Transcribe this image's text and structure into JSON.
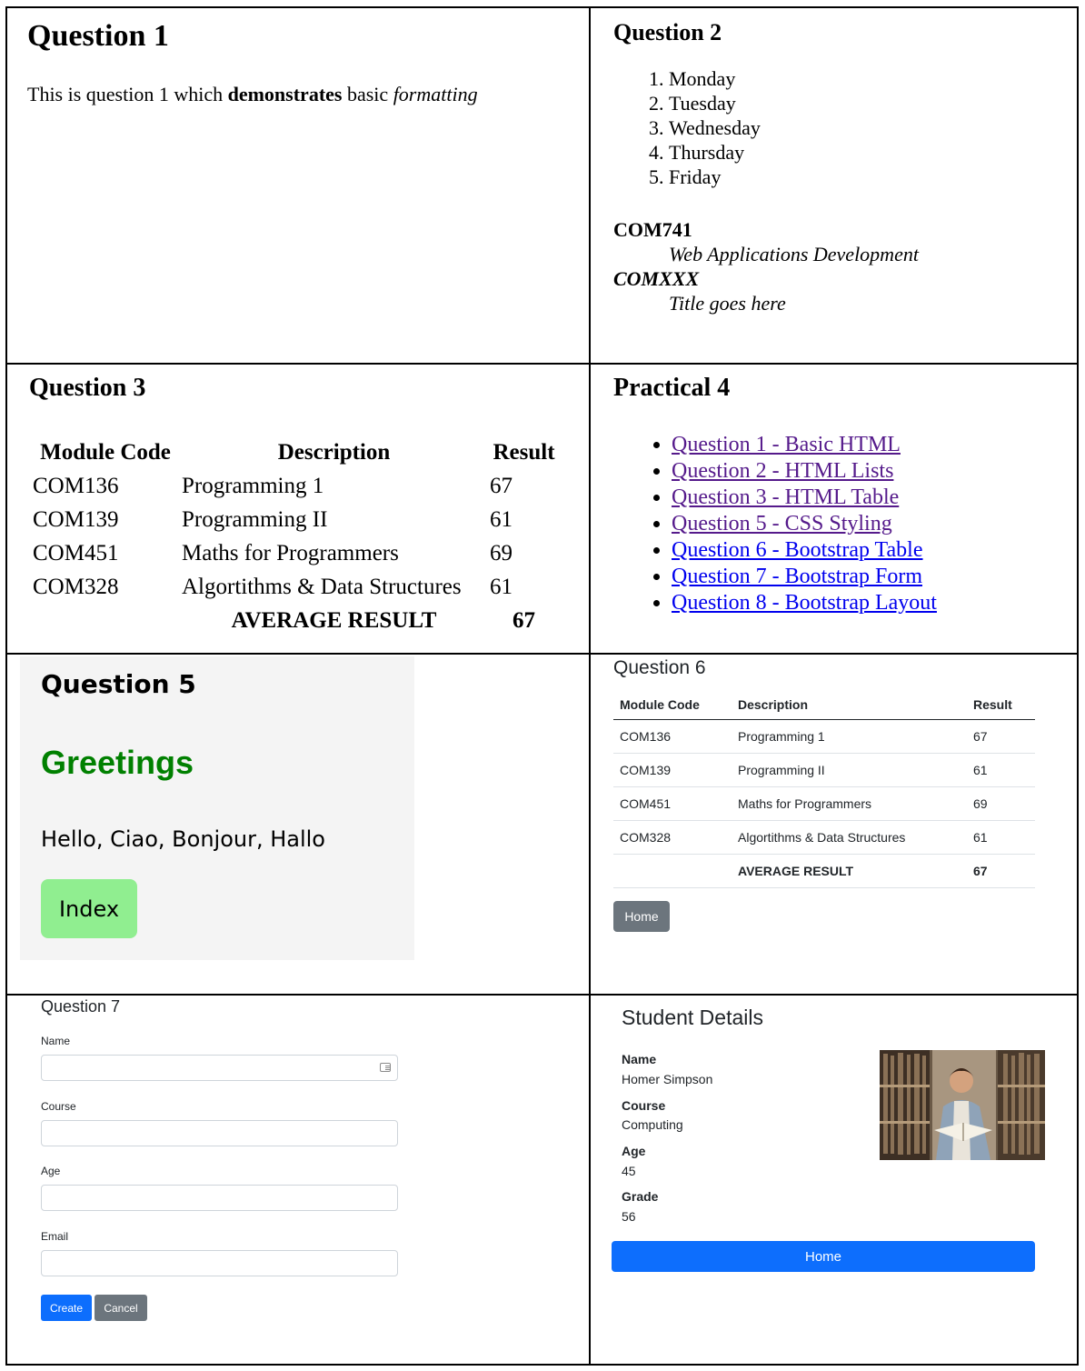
{
  "q1": {
    "title": "Question 1",
    "text_before": "This is question 1 which ",
    "text_bold": "demonstrates",
    "text_middle": " basic ",
    "text_italic": "formatting"
  },
  "q2": {
    "title": "Question 2",
    "days": [
      "Monday",
      "Tuesday",
      "Wednesday",
      "Thursday",
      "Friday"
    ],
    "definitions": [
      {
        "term": "COM741",
        "desc": "Web Applications Development"
      },
      {
        "term": "COMXXX",
        "desc": "Title goes here"
      }
    ]
  },
  "q3": {
    "title": "Question 3",
    "headers": [
      "Module Code",
      "Description",
      "Result"
    ],
    "rows": [
      [
        "COM136",
        "Programming 1",
        "67"
      ],
      [
        "COM139",
        "Programming II",
        "61"
      ],
      [
        "COM451",
        "Maths for Programmers",
        "69"
      ],
      [
        "COM328",
        "Algortithms & Data Structures",
        "61"
      ]
    ],
    "average_label": "AVERAGE RESULT",
    "average_value": "67"
  },
  "p4": {
    "title": "Practical 4",
    "links": [
      "Question 1 - Basic HTML",
      "Question 2 - HTML Lists",
      "Question 3 - HTML Table",
      "Question 5 - CSS Styling",
      "Question 6 - Bootstrap Table",
      "Question 7 - Bootstrap Form",
      "Question 8 - Bootstrap Layout"
    ],
    "visited_color": "#551a8b",
    "link_color": "#0000ee"
  },
  "q5": {
    "title": "Question 5",
    "greeting": "Greetings",
    "hello": "Hello, Ciao, Bonjour, Hallo",
    "button": "Index",
    "greeting_color": "#008000",
    "button_color": "#90ee90"
  },
  "q6": {
    "title": "Question 6",
    "headers": [
      "Module Code",
      "Description",
      "Result"
    ],
    "rows": [
      [
        "COM136",
        "Programming 1",
        "67"
      ],
      [
        "COM139",
        "Programming II",
        "61"
      ],
      [
        "COM451",
        "Maths for Programmers",
        "69"
      ],
      [
        "COM328",
        "Algortithms & Data Structures",
        "61"
      ]
    ],
    "average_label": "AVERAGE RESULT",
    "average_value": "67",
    "button": "Home"
  },
  "q7": {
    "title": "Question 7",
    "fields": [
      {
        "label": "Name",
        "value": "",
        "icon": "contact-card-icon"
      },
      {
        "label": "Course",
        "value": ""
      },
      {
        "label": "Age",
        "value": ""
      },
      {
        "label": "Email",
        "value": ""
      }
    ],
    "create_label": "Create",
    "cancel_label": "Cancel",
    "primary_color": "#0d6efd",
    "secondary_color": "#6c757d"
  },
  "student": {
    "title": "Student Details",
    "fields": [
      {
        "label": "Name",
        "value": "Homer Simpson"
      },
      {
        "label": "Course",
        "value": "Computing"
      },
      {
        "label": "Age",
        "value": "45"
      },
      {
        "label": "Grade",
        "value": "56"
      }
    ],
    "photo": "student-reading-book-in-library",
    "button": "Home"
  }
}
